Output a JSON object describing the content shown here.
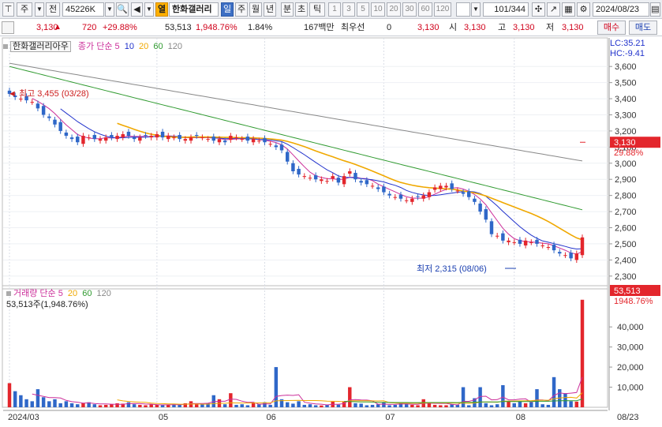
{
  "toolbar": {
    "market_label": "주",
    "prev_label": "전",
    "code": "45226K",
    "name_badge": "열",
    "stock_name": "한화갤러리",
    "periods": [
      "일",
      "주",
      "월",
      "년",
      "분",
      "초",
      "틱"
    ],
    "active_period": "일",
    "intervals": [
      "1",
      "3",
      "5",
      "10",
      "20",
      "30",
      "60",
      "120"
    ],
    "count": "101",
    "total": "/344",
    "date": "2024/08/23"
  },
  "info": {
    "price": "3,130",
    "change": "720",
    "change_pct": "+29.88%",
    "volume": "53,513",
    "volume_pct": "1,948.76%",
    "turnover": "1.84%",
    "amount": "167백만",
    "best_label": "최우선",
    "best_value": "0",
    "last": "3,130",
    "open_label": "시",
    "open": "3,130",
    "high_label": "고",
    "high": "3,130",
    "low_label": "저",
    "low": "3,130",
    "buy_label": "매수",
    "sell_label": "매도"
  },
  "price_legend": {
    "name": "한화갤러리아우",
    "label": "종가 단순",
    "ma5": "5",
    "ma10": "10",
    "ma20": "20",
    "ma60": "60",
    "ma120": "120",
    "lc": "LC:35.21",
    "hc": "HC:-9.41",
    "current_price": "3,130",
    "current_pct": "29.88%",
    "high_note": "최고 3,455 (03/28)",
    "low_note": "최저 2,315 (08/06)"
  },
  "volume_legend": {
    "label": "거래량 단순",
    "ma5": "5",
    "ma20": "20",
    "ma60": "60",
    "ma120": "120",
    "current": "53,513주(1,948.76%)",
    "current_value": "53,513",
    "current_pct": "1948.76%"
  },
  "colors": {
    "up": "#e3262c",
    "down": "#2f67c8",
    "ma5": "#cc2f9a",
    "ma10": "#2233cc",
    "ma20": "#f0a800",
    "ma60": "#2f9a2f",
    "ma120": "#888888"
  },
  "chart_data": [
    {
      "type": "candlestick",
      "title": "",
      "x_labels": [
        "2024/03",
        "05",
        "06",
        "07",
        "08",
        "08/23"
      ],
      "ylim": [
        2250,
        3650
      ],
      "yticks": [
        2300,
        2400,
        2500,
        2600,
        2700,
        2800,
        2900,
        3000,
        3100,
        3200,
        3300,
        3400,
        3500,
        3600
      ],
      "series": [
        {
          "name": "close",
          "values": [
            3430,
            3410,
            3400,
            3390,
            3380,
            3340,
            3300,
            3280,
            3240,
            3200,
            3170,
            3150,
            3130,
            3170,
            3160,
            3150,
            3150,
            3160,
            3160,
            3170,
            3180,
            3170,
            3150,
            3160,
            3170,
            3170,
            3180,
            3160,
            3170,
            3160,
            3150,
            3150,
            3160,
            3170,
            3160,
            3150,
            3140,
            3150,
            3130,
            3170,
            3160,
            3150,
            3140,
            3150,
            3140,
            3130,
            3120,
            3100,
            3080,
            3010,
            2950,
            2930,
            2920,
            2910,
            2900,
            2900,
            2890,
            2920,
            2880,
            2920,
            2950,
            2900,
            2880,
            2870,
            2860,
            2840,
            2820,
            2800,
            2790,
            2780,
            2770,
            2780,
            2790,
            2800,
            2820,
            2850,
            2860,
            2860,
            2840,
            2830,
            2810,
            2790,
            2760,
            2700,
            2650,
            2560,
            2550,
            2520,
            2520,
            2510,
            2500,
            2520,
            2510,
            2500,
            2490,
            2480,
            2460,
            2440,
            2430,
            2410,
            2440,
            2540
          ]
        },
        {
          "name": "5",
          "values": []
        },
        {
          "name": "10",
          "values": []
        },
        {
          "name": "20",
          "values": []
        },
        {
          "name": "60",
          "values": []
        },
        {
          "name": "120",
          "values": []
        }
      ],
      "current": 3130
    },
    {
      "type": "bar",
      "title": "",
      "ylim": [
        0,
        55000
      ],
      "yticks": [
        10000,
        20000,
        30000,
        40000
      ],
      "values": [
        12000,
        8000,
        6000,
        4000,
        3000,
        9000,
        5000,
        3000,
        4000,
        2000,
        3000,
        2000,
        1500,
        2000,
        2500,
        1500,
        1000,
        1200,
        1500,
        2000,
        1800,
        2500,
        1500,
        1200,
        1000,
        1500,
        1200,
        1000,
        1300,
        1500,
        1200,
        2000,
        3000,
        1500,
        1500,
        2000,
        6000,
        4000,
        1500,
        7000,
        1200,
        1500,
        1000,
        2000,
        1500,
        2500,
        1200,
        20000,
        4000,
        2500,
        1800,
        3000,
        1200,
        1500,
        1000,
        900,
        1300,
        2800,
        1300,
        3000,
        10000,
        2000,
        1800,
        1000,
        1200,
        1500,
        2400,
        1000,
        1200,
        2000,
        1800,
        1200,
        1000,
        4000,
        2500,
        1200,
        1000,
        1000,
        1500,
        1200,
        10000,
        1000,
        4500,
        10000,
        2000,
        1000,
        1500,
        11000,
        3000,
        2000,
        3000,
        2000,
        2500,
        9000,
        1500,
        1200,
        15000,
        9000,
        7000,
        3000,
        2800,
        53513
      ]
    }
  ]
}
